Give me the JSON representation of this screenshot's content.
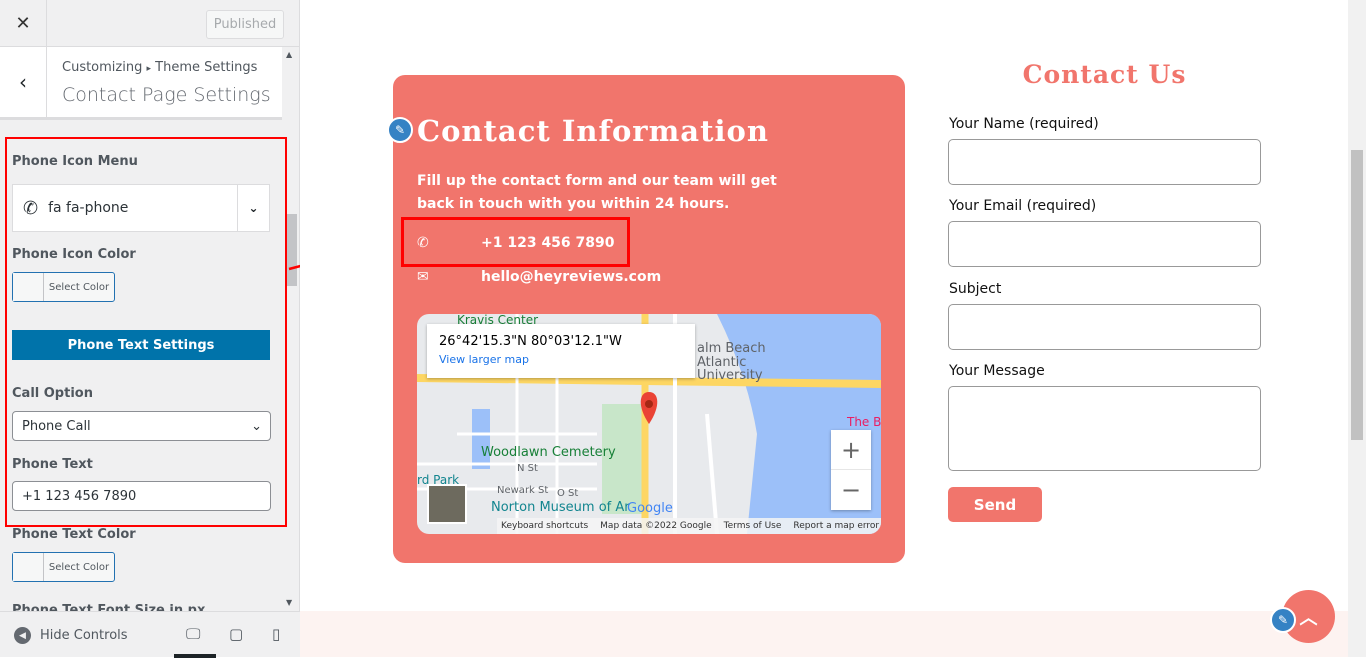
{
  "sidebar": {
    "close_icon": "close-icon",
    "published_label": "Published",
    "breadcrumb_root": "Customizing",
    "breadcrumb_sep": "▸",
    "breadcrumb_parent": "Theme Settings",
    "section_title": "Contact Page Settings",
    "phone_icon_menu_label": "Phone Icon Menu",
    "phone_icon_value": "fa fa-phone",
    "phone_icon_color_label": "Phone Icon Color",
    "select_color_label": "Select Color",
    "phone_text_settings_label": "Phone Text Settings",
    "call_option_label": "Call Option",
    "call_option_value": "Phone Call",
    "phone_text_label": "Phone Text",
    "phone_text_value": "+1 123 456 7890",
    "phone_text_color_label": "Phone Text Color",
    "phone_text_font_size_label": "Phone Text Font Size in px",
    "hide_controls_label": "Hide Controls",
    "devices": [
      "desktop",
      "tablet",
      "mobile"
    ]
  },
  "preview": {
    "accent_color": "#f1756c",
    "card": {
      "title": "Contact Information",
      "description": "Fill up the contact form and our team will get back in touch with you within 24 hours.",
      "phone": "+1 123 456 7890",
      "email": "hello@heyreviews.com"
    },
    "map": {
      "coords": "26°42'15.3\"N 80°03'12.1\"W",
      "view_larger": "View larger map",
      "labels": [
        "Kravis Center",
        "alm Beach",
        "Atlantic",
        "University",
        "Woodlawn Cemetery",
        "N St",
        "Newark St",
        "O St",
        "Norton Museum of Ar",
        "The B",
        "rd Park"
      ],
      "zoom_in": "+",
      "zoom_out": "−",
      "footer": [
        "Keyboard shortcuts",
        "Map data ©2022 Google",
        "Terms of Use",
        "Report a map error"
      ],
      "logo": "Google"
    },
    "form": {
      "title": "Contact Us",
      "fields": [
        "Your Name (required)",
        "Your Email (required)",
        "Subject",
        "Your Message"
      ],
      "send_label": "Send"
    }
  }
}
